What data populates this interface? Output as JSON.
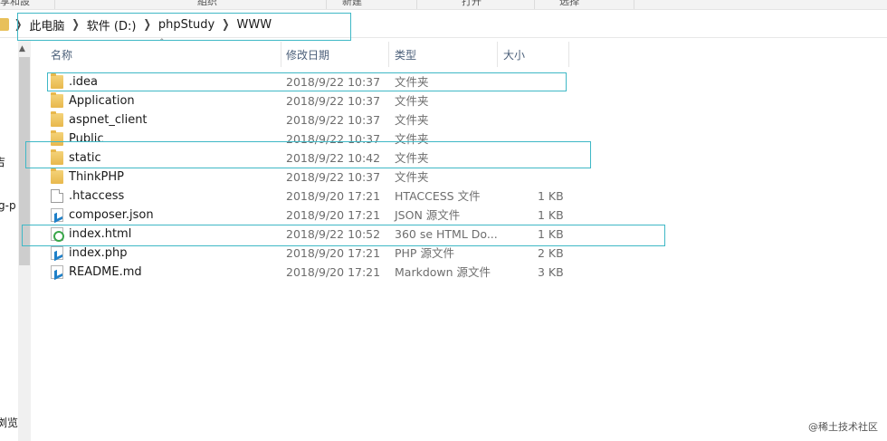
{
  "ribbon": {
    "labels": [
      "享和設",
      "組织",
      "新建",
      "打开",
      "选择"
    ]
  },
  "address": {
    "crumbs": [
      "此电脑",
      "软件 (D:)",
      "phpStudy",
      "WWW"
    ]
  },
  "left_fragments": [
    "吉",
    "g-p",
    "浏览"
  ],
  "columns": {
    "name": "名称",
    "modified": "修改日期",
    "type": "类型",
    "size": "大小"
  },
  "files": [
    {
      "name": ".idea",
      "modified": "2018/9/22 10:37",
      "type": "文件夹",
      "size": "",
      "icon": "folder-icon"
    },
    {
      "name": "Application",
      "modified": "2018/9/22 10:37",
      "type": "文件夹",
      "size": "",
      "icon": "folder-icon"
    },
    {
      "name": "aspnet_client",
      "modified": "2018/9/22 10:37",
      "type": "文件夹",
      "size": "",
      "icon": "folder-icon"
    },
    {
      "name": "Public",
      "modified": "2018/9/22 10:37",
      "type": "文件夹",
      "size": "",
      "icon": "folder-icon"
    },
    {
      "name": "static",
      "modified": "2018/9/22 10:42",
      "type": "文件夹",
      "size": "",
      "icon": "folder-icon"
    },
    {
      "name": "ThinkPHP",
      "modified": "2018/9/22 10:37",
      "type": "文件夹",
      "size": "",
      "icon": "folder-icon"
    },
    {
      "name": ".htaccess",
      "modified": "2018/9/20 17:21",
      "type": "HTACCESS 文件",
      "size": "1 KB",
      "icon": "file-icon"
    },
    {
      "name": "composer.json",
      "modified": "2018/9/20 17:21",
      "type": "JSON 源文件",
      "size": "1 KB",
      "icon": "code-file-icon"
    },
    {
      "name": "index.html",
      "modified": "2018/9/22 10:52",
      "type": "360 se HTML Do...",
      "size": "1 KB",
      "icon": "html-file-icon"
    },
    {
      "name": "index.php",
      "modified": "2018/9/20 17:21",
      "type": "PHP 源文件",
      "size": "2 KB",
      "icon": "code-file-icon"
    },
    {
      "name": "README.md",
      "modified": "2018/9/20 17:21",
      "type": "Markdown 源文件",
      "size": "3 KB",
      "icon": "code-file-icon"
    }
  ],
  "watermark": "@稀土技术社区",
  "colors": {
    "highlight": "#3fb8c6",
    "folder": "#e8b84c"
  }
}
